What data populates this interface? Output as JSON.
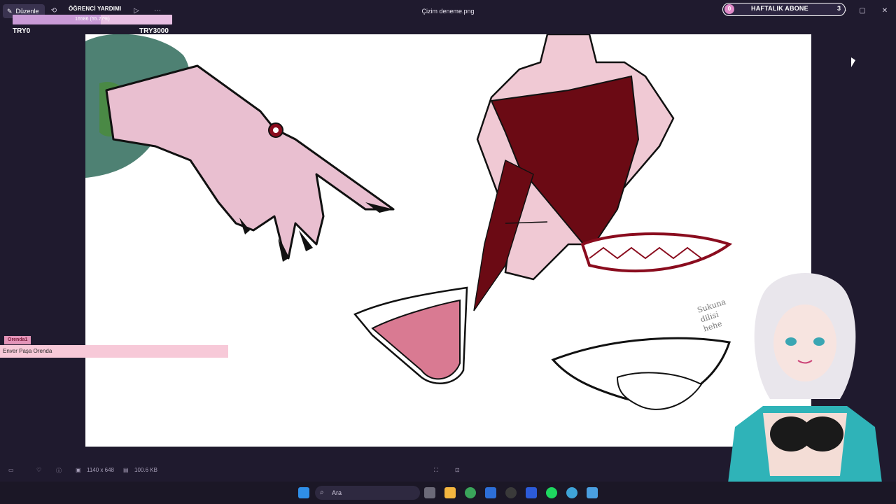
{
  "titlebar": {
    "edit_label": "Düzenle",
    "file_title": "Çizim deneme.png",
    "more_icon": "more-icon"
  },
  "overlay": {
    "ogr_label": "ÖĞRENCİ YARDIMI",
    "progress_text": "16586 (55.27%)",
    "progress_fraction": 0.5527,
    "try_left": "TRY0",
    "try_right": "TRY3000",
    "sub_count_left": "0",
    "sub_label": "HAFTALIK ABONE",
    "sub_count_right": "3"
  },
  "chat": {
    "user": "Orenda1",
    "message": "Enver Paşa Orenda"
  },
  "canvas": {
    "note_line1": "Sukuna",
    "note_line2": "dilisi",
    "note_line3": "hehe"
  },
  "status": {
    "dimensions": "1140 x 648",
    "size": "100.6 KB"
  },
  "taskbar": {
    "search_placeholder": "Ara"
  },
  "colors": {
    "accent": "#c99ad6",
    "wine": "#6b0a14",
    "skin": "#f0c9d4"
  }
}
